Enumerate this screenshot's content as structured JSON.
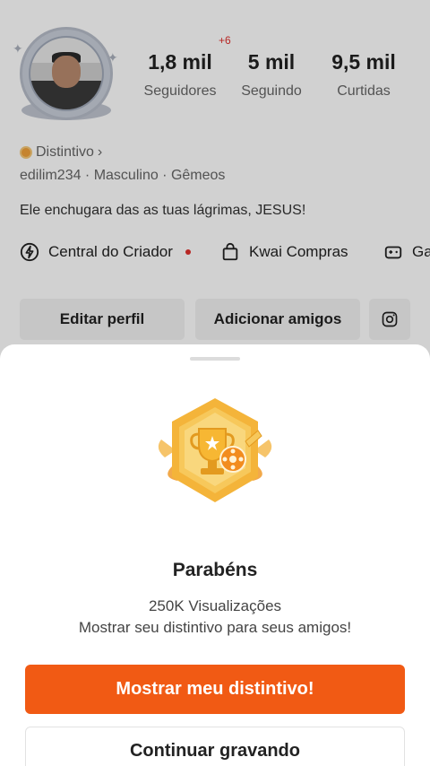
{
  "profile": {
    "stats": [
      {
        "value": "1,8 mil",
        "label": "Seguidores"
      },
      {
        "value": "5 mil",
        "label": "Seguindo"
      },
      {
        "value": "9,5 mil",
        "label": "Curtidas"
      }
    ],
    "new_count": "+6",
    "badge_label": "Distintivo",
    "badge_chevron": "›",
    "info": "edilim234 · Masculino · Gêmeos",
    "bio": "Ele enchugara das as tuas lágrimas, JESUS!",
    "links": {
      "creator": "Central do Criador",
      "shop": "Kwai Compras",
      "games": "Ga"
    },
    "buttons": {
      "edit": "Editar perfil",
      "add_friends": "Adicionar amigos"
    }
  },
  "sheet": {
    "title": "Parabéns",
    "subtitle": "250K Visualizações",
    "description": "Mostrar seu distintivo para seus amigos!",
    "primary_button": "Mostrar meu distintivo!",
    "secondary_button": "Continuar gravando"
  },
  "colors": {
    "accent": "#f15a14",
    "notification": "#e0302d",
    "medal_gold": "#f4b43a"
  }
}
